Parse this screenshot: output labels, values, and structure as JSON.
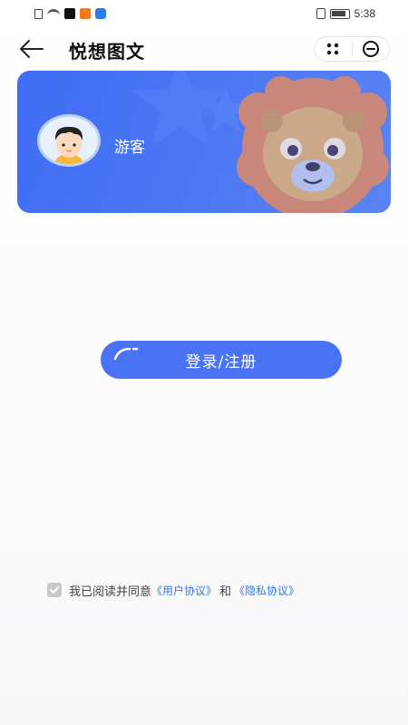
{
  "status_bar": {
    "time": "5:38",
    "icons": [
      "sim-icon",
      "wifi-icon",
      "tiktok-icon",
      "video-app-icon",
      "browser-app-icon",
      "vibrate-icon",
      "battery-icon"
    ]
  },
  "nav": {
    "title": "悦想图文",
    "back_icon": "arrow-left-icon",
    "more_icon": "dots-icon",
    "close_icon": "minus-circle-icon"
  },
  "profile": {
    "username": "游客",
    "avatar_icon": "boy-avatar"
  },
  "login": {
    "label": "登录/注册"
  },
  "agreement": {
    "checked": true,
    "prefix": "我已阅读并同意",
    "user_agreement": "《用户协议》",
    "conjunction": "和",
    "privacy_policy": "《隐私协议》"
  },
  "colors": {
    "banner": "#4a76f3",
    "button": "#4a72f5",
    "link": "#2c7be5"
  }
}
